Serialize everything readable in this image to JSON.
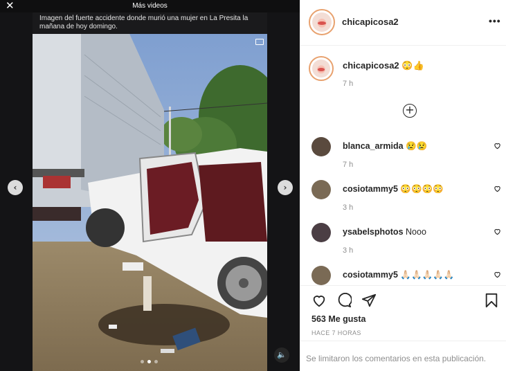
{
  "media": {
    "close_label": "✕",
    "more_videos_label": "Más videos",
    "caption": "Imagen del fuerte accidente donde murió una mujer en La Presita la mañana de hoy domingo.",
    "prev_arrow": "‹",
    "next_arrow": "›",
    "sound_icon": "🔈",
    "carousel_dots": 3,
    "carousel_active_index": 1
  },
  "post": {
    "header_username": "chicapicosa2",
    "more_menu": "•••",
    "owner_username": "chicapicosa2",
    "owner_caption": "😳👍",
    "owner_time": "7 h",
    "load_more_icon": "+"
  },
  "comments": [
    {
      "username": "blanca_armida",
      "text": "😢😢",
      "time": "7 h",
      "avatar_color": "#5a4a3e"
    },
    {
      "username": "cosiotammy5",
      "text": "😳😳😳😳",
      "time": "3 h",
      "avatar_color": "#7a6a55"
    },
    {
      "username": "ysabelsphotos",
      "text": "Nooo",
      "time": "3 h",
      "avatar_color": "#4b3e44"
    },
    {
      "username": "cosiotammy5",
      "text": "🙏🏻🙏🏻🙏🏻🙏🏻🙏🏻",
      "time": "",
      "avatar_color": "#7a6a55"
    }
  ],
  "actions": {
    "icons": [
      "heart-icon",
      "comment-icon",
      "share-icon",
      "bookmark-icon"
    ],
    "likes": "563 Me gusta",
    "posted": "HACE 7 HORAS"
  },
  "footer": {
    "limited_comments": "Se limitaron los comentarios en esta publicación."
  },
  "colors": {
    "story_ring": "#e8a16e",
    "text_primary": "#262626",
    "text_secondary": "#8e8e8e",
    "media_bg": "#1a1a1c"
  }
}
